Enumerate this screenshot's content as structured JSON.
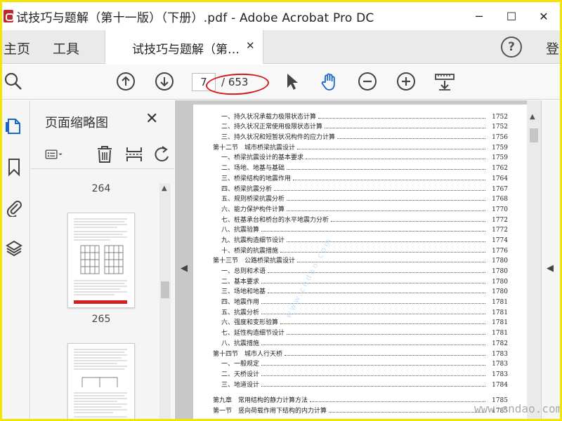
{
  "window": {
    "title": "试技巧与题解（第十一版）（下册）.pdf - Adobe Acrobat Pro DC",
    "minimize": "─",
    "maximize": "☐",
    "close": "✕"
  },
  "nav": {
    "home": "主页",
    "tools": "工具",
    "help": "?",
    "login": "登"
  },
  "doc_tab": {
    "label": "试技巧与题解（第…",
    "close": "✕"
  },
  "toolbar": {
    "current_page": "7",
    "total_pages": "/ 653"
  },
  "panel": {
    "title": "页面缩略图",
    "close": "✕",
    "thumbnails": [
      {
        "page": "264"
      },
      {
        "page": "265"
      }
    ]
  },
  "toc": [
    {
      "level": "l2",
      "text": "一、持久状况承载力极限状态计算",
      "page": "1752"
    },
    {
      "level": "l2",
      "text": "二、持久状况正常使用极限状态计算",
      "page": "1752"
    },
    {
      "level": "l2",
      "text": "三、持久状况和短暂状况构件的应力计算",
      "page": "1756"
    },
    {
      "level": "l1",
      "text": "第十二节　城市桥梁抗震设计",
      "page": "1759"
    },
    {
      "level": "l2",
      "text": "一、桥梁抗震设计的基本要求",
      "page": "1759"
    },
    {
      "level": "l2",
      "text": "二、场地、地基与基础",
      "page": "1762"
    },
    {
      "level": "l2",
      "text": "三、桥梁结构的地震作用",
      "page": "1764"
    },
    {
      "level": "l2",
      "text": "四、桥梁抗震分析",
      "page": "1767"
    },
    {
      "level": "l2",
      "text": "五、规则桥梁抗震分析",
      "page": "1768"
    },
    {
      "level": "l2",
      "text": "六、能力保护构件计算",
      "page": "1770"
    },
    {
      "level": "l2",
      "text": "七、桩基承台和桥台的水平地震力分析",
      "page": "1772"
    },
    {
      "level": "l2",
      "text": "八、抗震验算",
      "page": "1772"
    },
    {
      "level": "l2",
      "text": "九、抗震构造细节设计",
      "page": "1774"
    },
    {
      "level": "l2",
      "text": "十、桥梁的抗震措施",
      "page": "1776"
    },
    {
      "level": "l1",
      "text": "第十三节　公路桥梁抗震设计",
      "page": "1780"
    },
    {
      "level": "l2",
      "text": "一、总则和术语",
      "page": "1780"
    },
    {
      "level": "l2",
      "text": "二、基本要求",
      "page": "1780"
    },
    {
      "level": "l2",
      "text": "三、场地和地基",
      "page": "1780"
    },
    {
      "level": "l2",
      "text": "四、地震作用",
      "page": "1781"
    },
    {
      "level": "l2",
      "text": "五、抗震分析",
      "page": "1781"
    },
    {
      "level": "l2",
      "text": "六、强度和变形验算",
      "page": "1781"
    },
    {
      "level": "l2",
      "text": "七、延性构造细节设计",
      "page": "1781"
    },
    {
      "level": "l2",
      "text": "八、抗震措施",
      "page": "1782"
    },
    {
      "level": "l1",
      "text": "第十四节　城市人行天桥",
      "page": "1783"
    },
    {
      "level": "l2",
      "text": "一、一般规定",
      "page": "1783"
    },
    {
      "level": "l2",
      "text": "二、天桥设计",
      "page": "1783"
    },
    {
      "level": "l2",
      "text": "三、地道设计",
      "page": "1784"
    },
    {
      "level": "ch",
      "text": "第九章　常用结构的静力计算方法",
      "page": "1785"
    },
    {
      "level": "l1",
      "text": "第一节　竖向荷载作用下结构的内力计算",
      "page": "1785"
    }
  ],
  "watermark_site": "www.cndao.com",
  "colors": {
    "accent_red": "#d4171c",
    "frame_yellow": "#f2e600"
  }
}
